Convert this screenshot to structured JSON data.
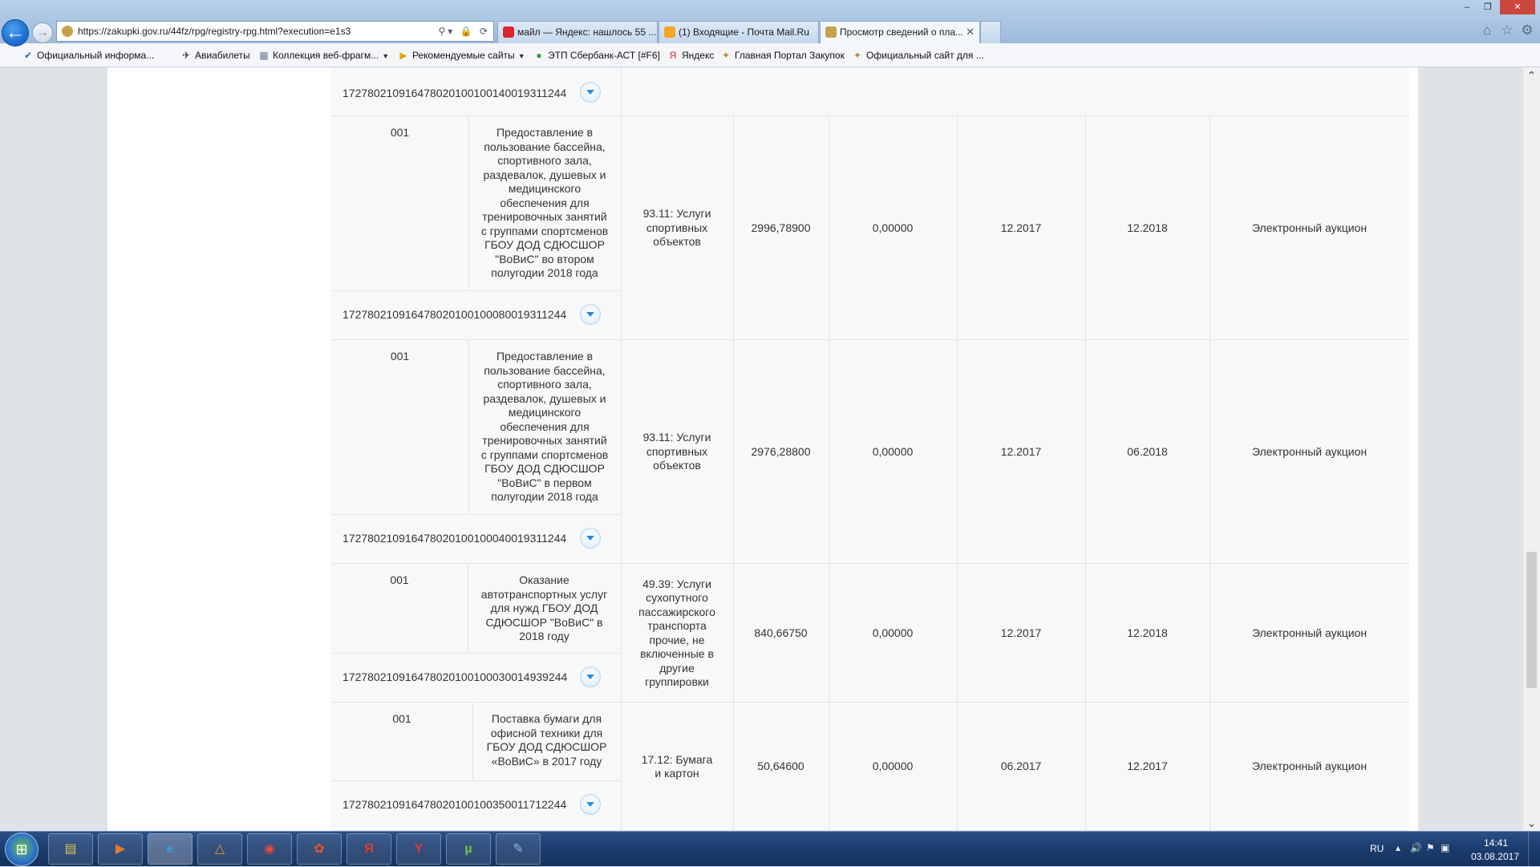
{
  "browser": {
    "address_url": "https://zakupki.gov.ru/44fz/rpg/registry-rpg.html?execution=e1s3",
    "tabs": [
      {
        "label": "майл — Яндекс: нашлось 55 ...",
        "icon": "yandex-icon",
        "color": "#d9262b"
      },
      {
        "label": "(1) Входящие - Почта Mail.Ru",
        "icon": "mailru-icon",
        "color": "#f5a623"
      },
      {
        "label": "Просмотр сведений о пла...",
        "icon": "emblem-icon",
        "color": "#c7a14a",
        "active": true
      }
    ],
    "window_buttons": {
      "minimize": "‒",
      "maximize": "❐",
      "close": "✕"
    }
  },
  "favorites": [
    {
      "label": "Официальный информа...",
      "icon": "checkmark-icon"
    },
    {
      "label": "Авиабилеты",
      "icon": "plane-icon"
    },
    {
      "label": "Коллекция веб-фрагм...",
      "icon": "webslice-icon",
      "dropdown": true
    },
    {
      "label": "Рекомендуемые сайты",
      "icon": "suggested-sites-icon",
      "dropdown": true
    },
    {
      "label": "ЭТП Сбербанк-АСТ [#F6]",
      "icon": "sberbank-icon"
    },
    {
      "label": "Яндекс",
      "icon": "yandex-icon"
    },
    {
      "label": "Главная Портал Закупок",
      "icon": "emblem-icon"
    },
    {
      "label": "Официальный сайт для ...",
      "icon": "emblem-icon"
    }
  ],
  "table": {
    "top_partial_code": "172780210916478020100100140019311244",
    "rows": [
      {
        "pos": "001",
        "name": "Предоставление в пользование бассейна, спортивного зала, раздевалок, душевых и медицинского обеспечения для тренировочных занятий с группами спортсменов ГБОУ ДОД СДЮСШОР \"ВоВиС\" во втором полугодии 2018 года",
        "code": "172780210916478020100100080019311244",
        "okpd": "93.11: Услуги спортивных объектов",
        "amount": "2996,78900",
        "advance": "0,00000",
        "start": "12.2017",
        "end": "12.2018",
        "method": "Электронный аукцион"
      },
      {
        "pos": "001",
        "name": "Предоставление в пользование бассейна, спортивного зала, раздевалок, душевых и медицинского обеспечения для тренировочных занятий с группами спортсменов ГБОУ ДОД СДЮСШОР \"ВоВиС\" в первом полугодии 2018 года",
        "code": "172780210916478020100100040019311244",
        "okpd": "93.11: Услуги спортивных объектов",
        "amount": "2976,28800",
        "advance": "0,00000",
        "start": "12.2017",
        "end": "06.2018",
        "method": "Электронный аукцион"
      },
      {
        "pos": "001",
        "name": "Оказание автотранспортных услуг для нужд ГБОУ ДОД СДЮСШОР \"ВоВиС\" в 2018 году",
        "code": "172780210916478020100100030014939244",
        "okpd": "49.39: Услуги сухопутного пассажирского транспорта прочие, не включенные в другие группировки",
        "amount": "840,66750",
        "advance": "0,00000",
        "start": "12.2017",
        "end": "12.2018",
        "method": "Электронный аукцион"
      },
      {
        "pos": "001",
        "name": "Поставка бумаги для офисной техники для ГБОУ ДОД СДЮСШОР «ВоВиС» в 2017 году",
        "code": "172780210916478020100100350011712244",
        "okpd": "17.12: Бумага и картон",
        "amount": "50,64600",
        "advance": "0,00000",
        "start": "06.2017",
        "end": "12.2017",
        "method": "Электронный аукцион"
      }
    ]
  },
  "taskbar": {
    "start_icon": "⊞",
    "apps": [
      {
        "name": "explorer-icon",
        "glyph": "▤",
        "color": "#e8c25a"
      },
      {
        "name": "media-player-icon",
        "glyph": "▶",
        "color": "#e37b2d"
      },
      {
        "name": "internet-explorer-icon",
        "glyph": "e",
        "color": "#3c9be0",
        "active": true
      },
      {
        "name": "avast-icon",
        "glyph": "△",
        "color": "#f29a1f"
      },
      {
        "name": "chrome-icon",
        "glyph": "◉",
        "color": "#dd4b39"
      },
      {
        "name": "film-reel-icon",
        "glyph": "✿",
        "color": "#e2572b"
      },
      {
        "name": "yandex-icon",
        "glyph": "Я",
        "color": "#e23a2e"
      },
      {
        "name": "yandex-browser-icon",
        "glyph": "Y",
        "color": "#e23a2e"
      },
      {
        "name": "utorrent-icon",
        "glyph": "µ",
        "color": "#77c043"
      },
      {
        "name": "paint-icon",
        "glyph": "✎",
        "color": "#8fb8de"
      }
    ],
    "language": "RU",
    "time": "14:41",
    "date": "03.08.2017"
  }
}
